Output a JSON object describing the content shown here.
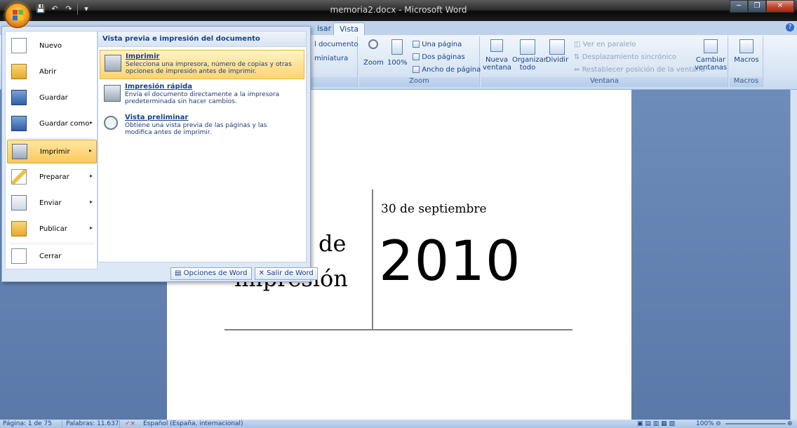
{
  "window": {
    "title": "memoria2.docx - Microsoft Word"
  },
  "quick_access": {
    "save": "💾",
    "undo": "↶",
    "redo": "↷",
    "customize": "▾"
  },
  "ribbon": {
    "tabs": [
      "isar",
      "Vista"
    ],
    "groups": {
      "doc_views": {
        "btn1": "l documento",
        "btn2": "miniatura"
      },
      "zoom": {
        "label": "Zoom",
        "zoom_btn": "Zoom",
        "pct_btn": "100%",
        "una": "Una página",
        "dos": "Dos páginas",
        "ancho": "Ancho de página"
      },
      "ventana": {
        "label": "Ventana",
        "nueva": "Nueva ventana",
        "organizar": "Organizar todo",
        "dividir": "Dividir",
        "paralelo": "Ver en paralelo",
        "desplaz": "Desplazamiento sincrónico",
        "restablecer": "Restablecer posición de la ventana",
        "cambiar": "Cambiar ventanas"
      },
      "macros": {
        "label": "Macros",
        "btn": "Macros"
      }
    }
  },
  "office_menu": {
    "items": [
      {
        "label": "Nuevo",
        "arrow": ""
      },
      {
        "label": "Abrir",
        "arrow": ""
      },
      {
        "label": "Guardar",
        "arrow": ""
      },
      {
        "label": "Guardar como",
        "arrow": "▸"
      },
      {
        "label": "Imprimir",
        "arrow": "▸"
      },
      {
        "label": "Preparar",
        "arrow": "▸"
      },
      {
        "label": "Enviar",
        "arrow": "▸"
      },
      {
        "label": "Publicar",
        "arrow": "▸"
      },
      {
        "label": "Cerrar",
        "arrow": ""
      }
    ],
    "submenu": {
      "header": "Vista previa e impresión del documento",
      "items": [
        {
          "title": "Imprimir",
          "desc": "Selecciona una impresora, número de copias y otras opciones de impresión antes de imprimir."
        },
        {
          "title": "Impresión rápida",
          "desc": "Envía el documento directamente a la impresora predeterminada sin hacer cambios."
        },
        {
          "title": "Vista preliminar",
          "desc": "Obtiene una vista previa de las páginas y las modifica antes de imprimir."
        }
      ]
    },
    "options_button": "Opciones de Word",
    "exit_button": "Salir de Word"
  },
  "document": {
    "date": "30 de septiembre",
    "year": "2010",
    "left_line1": "de",
    "left_line2": "impresión"
  },
  "status": {
    "page": "Página: 1 de 75",
    "words": "Palabras: 11.637",
    "language": "Español (España, internacional)",
    "zoom": "100%"
  },
  "colors": {
    "accent_orange": "#f5a623",
    "ribbon_blue": "#15428b",
    "menu_highlight": "#fcc85d"
  }
}
